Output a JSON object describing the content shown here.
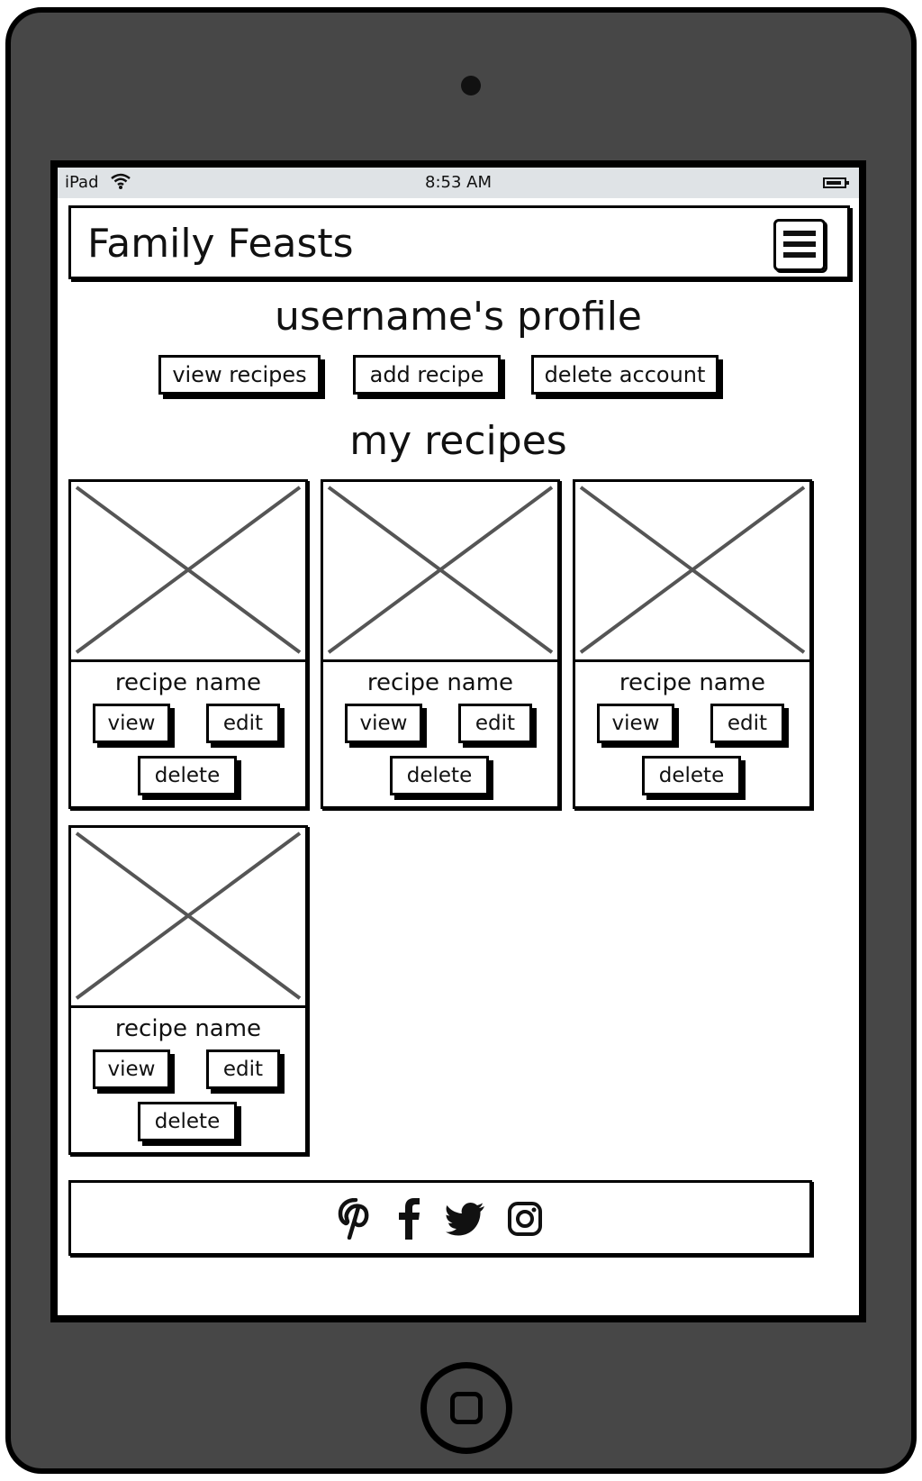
{
  "status_bar": {
    "device": "iPad",
    "time": "8:53 AM"
  },
  "header": {
    "brand": "Family Feasts",
    "menu_icon": "hamburger-menu-icon"
  },
  "profile": {
    "title": "username's profile",
    "buttons": {
      "view_recipes": "view recipes",
      "add_recipe": "add recipe",
      "delete_account": "delete account"
    }
  },
  "recipes": {
    "title": "my recipes",
    "cards": [
      {
        "name": "recipe name",
        "view": "view",
        "edit": "edit",
        "delete": "delete"
      },
      {
        "name": "recipe name",
        "view": "view",
        "edit": "edit",
        "delete": "delete"
      },
      {
        "name": "recipe name",
        "view": "view",
        "edit": "edit",
        "delete": "delete"
      },
      {
        "name": "recipe name",
        "view": "view",
        "edit": "edit",
        "delete": "delete"
      }
    ]
  },
  "footer": {
    "social_icons": [
      "pinterest-icon",
      "facebook-icon",
      "twitter-icon",
      "instagram-icon"
    ]
  },
  "colors": {
    "device_frame": "#474747",
    "status_bar": "#dfe3e6",
    "placeholder_lines": "#555555"
  }
}
